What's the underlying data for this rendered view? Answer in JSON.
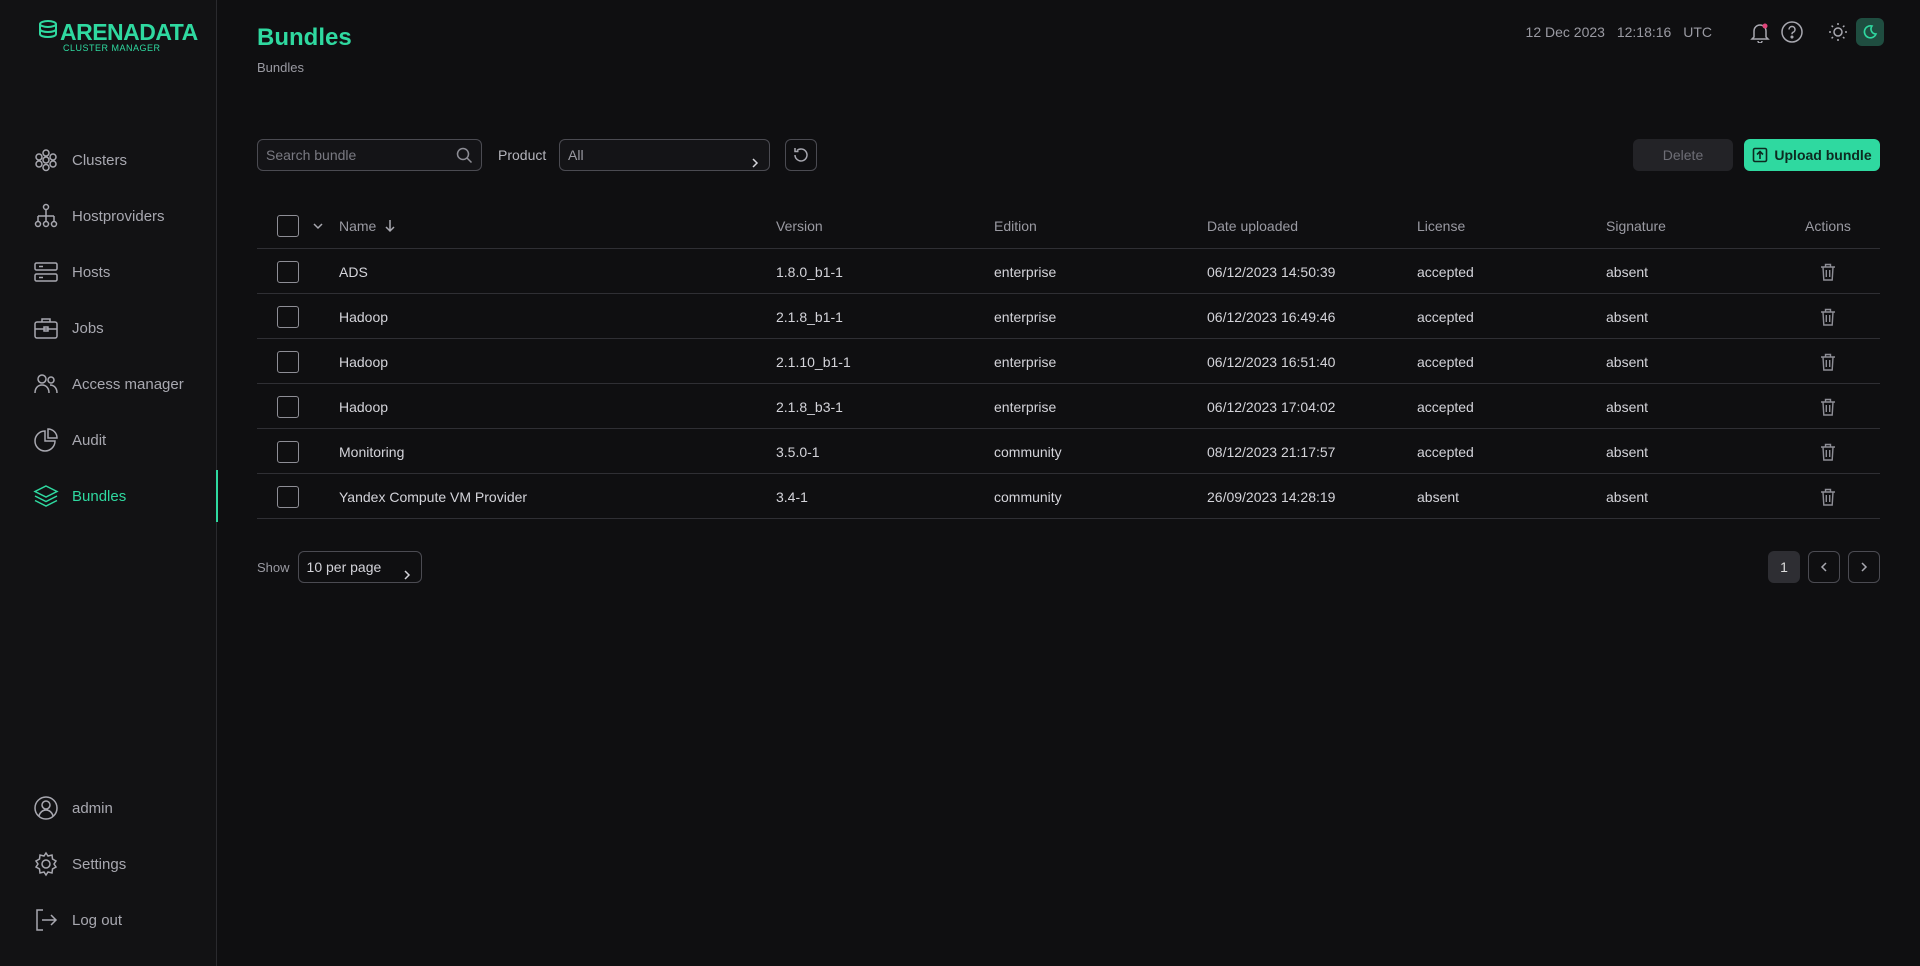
{
  "brand": {
    "name": "ARENADATA",
    "subtitle": "CLUSTER MANAGER"
  },
  "colors": {
    "accent": "#2fd9a0",
    "background": "#0f0f11",
    "sidebar": "#121214",
    "text_muted": "#9a9aa2"
  },
  "sidebar": {
    "items": [
      {
        "label": "Clusters",
        "icon": "clusters-icon"
      },
      {
        "label": "Hostproviders",
        "icon": "hostproviders-icon"
      },
      {
        "label": "Hosts",
        "icon": "hosts-icon"
      },
      {
        "label": "Jobs",
        "icon": "jobs-icon"
      },
      {
        "label": "Access manager",
        "icon": "access-manager-icon"
      },
      {
        "label": "Audit",
        "icon": "audit-icon"
      },
      {
        "label": "Bundles",
        "icon": "bundles-icon",
        "active": true
      }
    ],
    "bottom": [
      {
        "label": "admin",
        "icon": "user-icon"
      },
      {
        "label": "Settings",
        "icon": "gear-icon"
      },
      {
        "label": "Log out",
        "icon": "logout-icon"
      }
    ]
  },
  "header": {
    "title": "Bundles",
    "breadcrumb": "Bundles",
    "date": "12 Dec 2023",
    "time": "12:18:16",
    "timezone": "UTC"
  },
  "toolbar": {
    "search_placeholder": "Search bundle",
    "product_label": "Product",
    "product_value": "All",
    "delete_label": "Delete",
    "upload_label": "Upload bundle"
  },
  "table": {
    "columns": {
      "name": "Name",
      "version": "Version",
      "edition": "Edition",
      "date": "Date uploaded",
      "license": "License",
      "signature": "Signature",
      "actions": "Actions"
    },
    "rows": [
      {
        "name": "ADS",
        "version": "1.8.0_b1-1",
        "edition": "enterprise",
        "date": "06/12/2023 14:50:39",
        "license": "accepted",
        "signature": "absent"
      },
      {
        "name": "Hadoop",
        "version": "2.1.8_b1-1",
        "edition": "enterprise",
        "date": "06/12/2023 16:49:46",
        "license": "accepted",
        "signature": "absent"
      },
      {
        "name": "Hadoop",
        "version": "2.1.10_b1-1",
        "edition": "enterprise",
        "date": "06/12/2023 16:51:40",
        "license": "accepted",
        "signature": "absent"
      },
      {
        "name": "Hadoop",
        "version": "2.1.8_b3-1",
        "edition": "enterprise",
        "date": "06/12/2023 17:04:02",
        "license": "accepted",
        "signature": "absent"
      },
      {
        "name": "Monitoring",
        "version": "3.5.0-1",
        "edition": "community",
        "date": "08/12/2023 21:17:57",
        "license": "accepted",
        "signature": "absent"
      },
      {
        "name": "Yandex Compute VM Provider",
        "version": "3.4-1",
        "edition": "community",
        "date": "26/09/2023 14:28:19",
        "license": "absent",
        "signature": "absent"
      }
    ]
  },
  "pagination": {
    "show_label": "Show",
    "per_page": "10 per page",
    "current_page": "1"
  }
}
